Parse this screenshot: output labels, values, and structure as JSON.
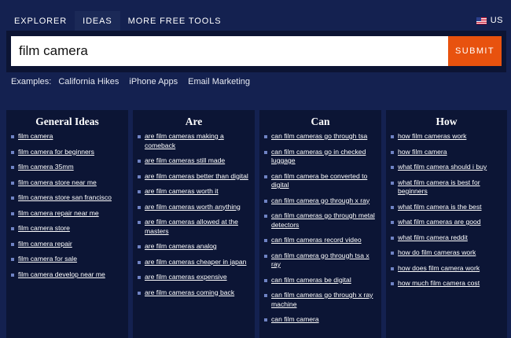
{
  "nav": {
    "tabs": [
      {
        "label": "EXPLORER"
      },
      {
        "label": "IDEAS"
      },
      {
        "label": "MORE FREE TOOLS"
      }
    ],
    "active_tab": "IDEAS",
    "locale": {
      "label": "US",
      "flag_icon": "us-flag-icon"
    }
  },
  "search": {
    "value": "film camera",
    "submit_label": "SUBMIT"
  },
  "examples": {
    "label": "Examples:",
    "items": [
      "California Hikes",
      "iPhone Apps",
      "Email Marketing"
    ]
  },
  "columns": [
    {
      "heading": "General Ideas",
      "items": [
        "film camera",
        "film camera for beginners",
        "film camera 35mm",
        "film camera store near me",
        "film camera store san francisco",
        "film camera repair near me",
        "film camera store",
        "film camera repair",
        "film camera for sale",
        "film camera develop near me"
      ]
    },
    {
      "heading": "Are",
      "items": [
        "are film cameras making a comeback",
        "are film cameras still made",
        "are film cameras better than digital",
        "are film cameras worth it",
        "are film cameras worth anything",
        "are film cameras allowed at the masters",
        "are film cameras analog",
        "are film cameras cheaper in japan",
        "are film cameras expensive",
        "are film cameras coming back"
      ]
    },
    {
      "heading": "Can",
      "items": [
        "can film cameras go through tsa",
        "can film cameras go in checked luggage",
        "can film camera be converted to digital",
        "can film camera go through x ray",
        "can film cameras go through metal detectors",
        "can film cameras record video",
        "can film camera go through tsa x ray",
        "can film cameras be digital",
        "can film cameras go through x ray machine",
        "can film camera"
      ]
    },
    {
      "heading": "How",
      "items": [
        "how film cameras work",
        "how film camera",
        "what film camera should i buy",
        "what film camera is best for beginners",
        "what film camera is the best",
        "what film cameras are good",
        "what film camera reddit",
        "how do film cameras work",
        "how does film camera work",
        "how much film camera cost"
      ]
    }
  ],
  "colors": {
    "background": "#142150",
    "panel": "#0c1535",
    "accent": "#e8520e",
    "bullet": "#6f83c4"
  }
}
